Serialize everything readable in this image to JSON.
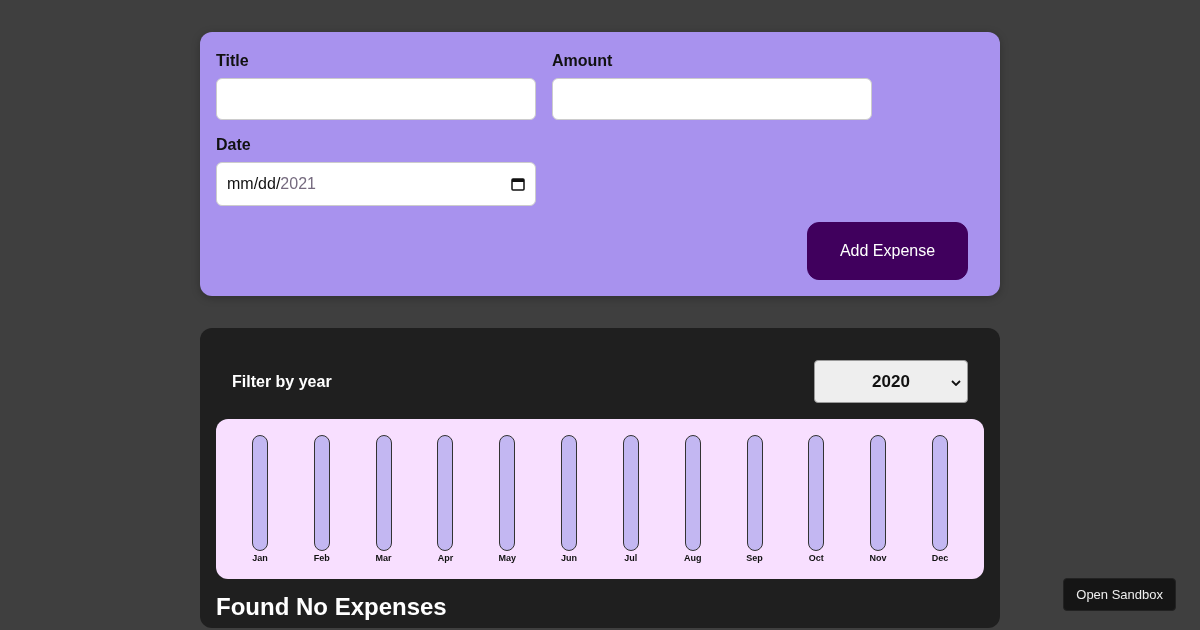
{
  "form": {
    "fields": [
      {
        "kind": "text",
        "label": "Title"
      },
      {
        "kind": "text",
        "label": "Amount"
      },
      {
        "kind": "date",
        "label": "Date",
        "format": "mm/dd/",
        "year": "2021"
      }
    ],
    "submit": "Add Expense"
  },
  "expenses": {
    "filter": {
      "label": "Filter by year",
      "selected_year": "2020"
    },
    "months": [
      {
        "label": "Jan",
        "level": 0
      },
      {
        "label": "Feb",
        "level": 0
      },
      {
        "label": "Mar",
        "level": 0
      },
      {
        "label": "Apr",
        "level": 0
      },
      {
        "label": "May",
        "level": 0
      },
      {
        "label": "Jun",
        "level": 0
      },
      {
        "label": "Jul",
        "level": 0
      },
      {
        "label": "Aug",
        "level": 0
      },
      {
        "label": "Sep",
        "level": 0
      },
      {
        "label": "Oct",
        "level": 0
      },
      {
        "label": "Nov",
        "level": 0
      },
      {
        "label": "Dec",
        "level": 0
      }
    ],
    "empty_message": "Found No Expenses"
  },
  "sandbox_button": "Open Sandbox"
}
